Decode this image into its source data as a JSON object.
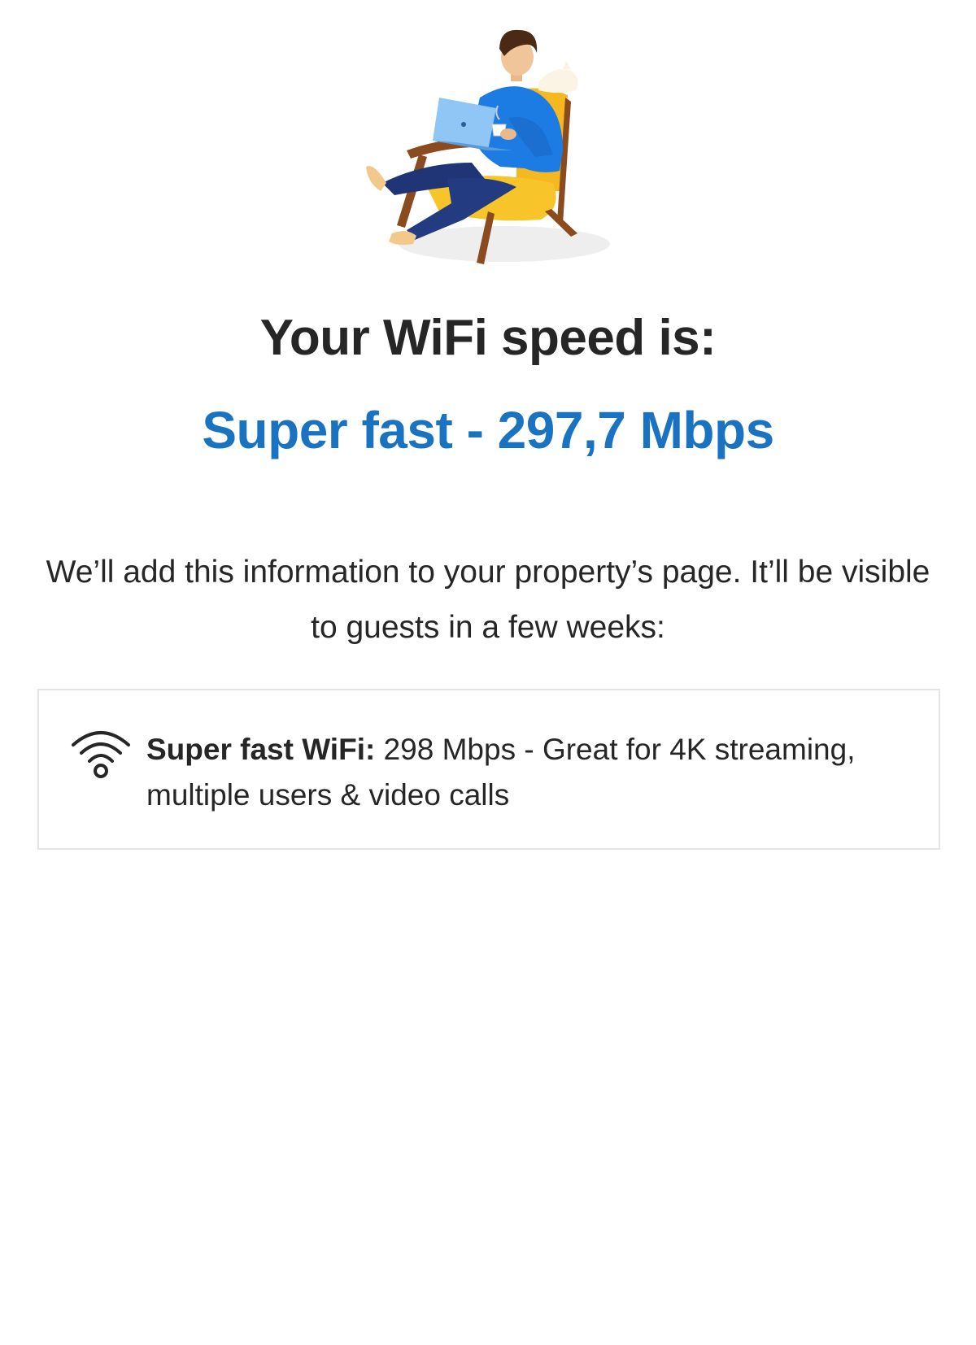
{
  "illustration": {
    "icon": "person-relaxing-in-armchair-with-laptop-illustration"
  },
  "heading": "Your WiFi speed is:",
  "result": {
    "text": "Super fast - 297,7 Mbps",
    "color": "#1a73c1"
  },
  "description": "We’ll add this information to your property’s page. It’ll be visible to guests in a few weeks:",
  "card": {
    "icon": "wifi-icon",
    "label": "Super fast WiFi:",
    "text": " 298 Mbps - Great for 4K streaming, multiple users & video calls"
  }
}
